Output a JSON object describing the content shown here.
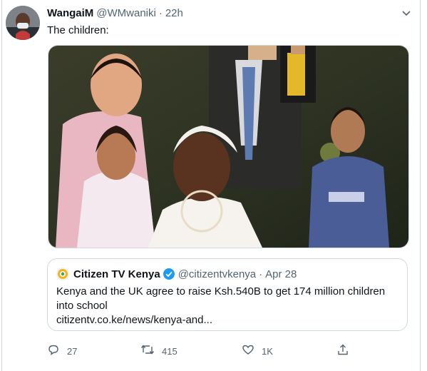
{
  "tweet": {
    "author_name": "WangaiM",
    "author_handle": "@WMwaniki",
    "separator": "·",
    "time": "22h",
    "text": "The children:",
    "more_icon": "chevron-down-icon"
  },
  "quoted_tweet": {
    "author_name": "Citizen TV Kenya",
    "author_handle": "@citizentvkenya",
    "separator": "·",
    "time": "Apr 28",
    "text": "Kenya and the UK agree to raise Ksh.540B to get 174 million children into school",
    "link": "citizentv.co.ke/news/kenya-and...",
    "verified_icon": "verified-badge-icon"
  },
  "actions": {
    "reply_count": "27",
    "retweet_count": "415",
    "like_count": "1K",
    "icons": [
      "reply-icon",
      "retweet-icon",
      "like-icon",
      "share-icon"
    ]
  },
  "colors": {
    "text_primary": "#0f1419",
    "text_secondary": "#536471",
    "border": "#cfd9de",
    "verified": "#1d9bf0"
  }
}
